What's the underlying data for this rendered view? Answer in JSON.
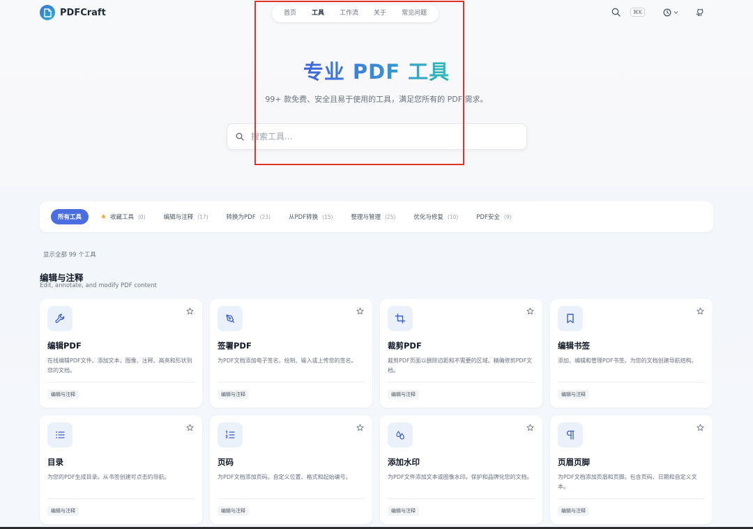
{
  "brand": {
    "name": "PDFCraft",
    "icon": "file-icon"
  },
  "nav": {
    "items": [
      "首页",
      "工具",
      "工作流",
      "关于",
      "常见问题"
    ],
    "active_index": 1
  },
  "header": {
    "shortcut_label": "⌘K",
    "icons": [
      "search-icon",
      "clock-icon",
      "github-icon"
    ]
  },
  "hero": {
    "title": "专业 PDF 工具",
    "subtitle": "99+ 款免费、安全且易于使用的工具，满足您所有的 PDF 需求。",
    "search_placeholder": "搜索工具..."
  },
  "filters": [
    {
      "label": "所有工具",
      "count": "",
      "active": true
    },
    {
      "label": "收藏工具",
      "count": "(0)",
      "icon": "star-icon"
    },
    {
      "label": "编辑与注释",
      "count": "(17)"
    },
    {
      "label": "转换为PDF",
      "count": "(23)"
    },
    {
      "label": "从PDF转换",
      "count": "(15)"
    },
    {
      "label": "整理与管理",
      "count": "(25)"
    },
    {
      "label": "优化与修复",
      "count": "(10)"
    },
    {
      "label": "PDF安全",
      "count": "(9)"
    }
  ],
  "summary": "显示全部 99 个工具",
  "section": {
    "title": "编辑与注释",
    "subtitle": "Edit, annotate, and modify PDF content"
  },
  "cards": [
    {
      "title": "编辑PDF",
      "desc": "在线编辑PDF文件。添加文本、图像、注释、高亮和形状到您的文档。",
      "tag": "编辑与注释",
      "icon": "wrench-icon"
    },
    {
      "title": "签署PDF",
      "desc": "为PDF文档添加电子签名。绘制、输入或上传您的签名。",
      "tag": "编辑与注释",
      "icon": "pen-nib-icon"
    },
    {
      "title": "裁剪PDF",
      "desc": "裁剪PDF页面以删除边距和不需要的区域。精确修剪PDF文档。",
      "tag": "编辑与注释",
      "icon": "crop-icon"
    },
    {
      "title": "编辑书签",
      "desc": "添加、编辑和管理PDF书签。为您的文档创建导航结构。",
      "tag": "编辑与注释",
      "icon": "bookmark-icon"
    },
    {
      "title": "目录",
      "desc": "为您的PDF生成目录。从书签创建可点击的导航。",
      "tag": "编辑与注释",
      "icon": "list-icon"
    },
    {
      "title": "页码",
      "desc": "为PDF文档添加页码。自定义位置、格式和起始编号。",
      "tag": "编辑与注释",
      "icon": "numbered-list-icon"
    },
    {
      "title": "添加水印",
      "desc": "为PDF文件添加文本或图像水印。保护和品牌化您的文档。",
      "tag": "编辑与注释",
      "icon": "droplets-icon"
    },
    {
      "title": "页眉页脚",
      "desc": "为PDF文档添加页眉和页脚。包含页码、日期和自定义文本。",
      "tag": "编辑与注释",
      "icon": "pilcrow-icon"
    }
  ],
  "colors": {
    "accent": "#4a6ee0",
    "highlight": "#e0322b",
    "icon_color": "#3b5fc9"
  }
}
